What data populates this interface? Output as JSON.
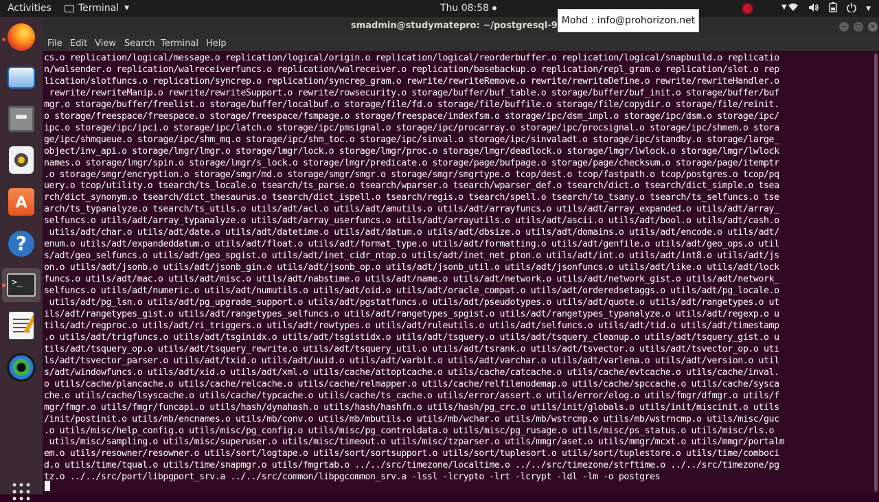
{
  "topbar": {
    "activities": "Activities",
    "app_name": "Terminal",
    "clock": "Thu 08:58"
  },
  "window": {
    "title": "smadmin@studymatepro: ~/postgresql-9.6.0-",
    "menu": [
      "File",
      "Edit",
      "View",
      "Search",
      "Terminal",
      "Help"
    ]
  },
  "overlay": {
    "text": "Mohd : info@prohorizon.net"
  },
  "dock": {
    "items": [
      "firefox-icon",
      "thunderbird-icon",
      "files-icon",
      "rhythmbox-icon",
      "software-center-icon",
      "help-icon",
      "terminal-icon",
      "text-editor-icon",
      "webcam-icon"
    ],
    "apps_grid": "show-applications-icon"
  },
  "terminal": {
    "lines": [
      "cs.o replication/logical/message.o replication/logical/origin.o replication/logical/reorderbuffer.o replication/logical/snapbuild.o replicatio",
      "n/walsender.o replication/walreceiverfuncs.o replication/walreceiver.o replication/basebackup.o replication/repl_gram.o replication/slot.o rep",
      "lication/slotfuncs.o replication/syncrep.o replication/syncrep_gram.o rewrite/rewriteRemove.o rewrite/rewriteDefine.o rewrite/rewriteHandler.o",
      " rewrite/rewriteManip.o rewrite/rewriteSupport.o rewrite/rowsecurity.o storage/buffer/buf_table.o storage/buffer/buf_init.o storage/buffer/buf",
      "mgr.o storage/buffer/freelist.o storage/buffer/localbuf.o storage/file/fd.o storage/file/buffile.o storage/file/copydir.o storage/file/reinit.",
      "o storage/freespace/freespace.o storage/freespace/fsmpage.o storage/freespace/indexfsm.o storage/ipc/dsm_impl.o storage/ipc/dsm.o storage/ipc/",
      "ipc.o storage/ipc/ipci.o storage/ipc/latch.o storage/ipc/pmsignal.o storage/ipc/procarray.o storage/ipc/procsignal.o storage/ipc/shmem.o stora",
      "ge/ipc/shmqueue.o storage/ipc/shm_mq.o storage/ipc/shm_toc.o storage/ipc/sinval.o storage/ipc/sinvaladt.o storage/ipc/standby.o storage/large_",
      "object/inv_api.o storage/lmgr/lmgr.o storage/lmgr/lock.o storage/lmgr/proc.o storage/lmgr/deadlock.o storage/lmgr/lwlock.o storage/lmgr/lwlock",
      "names.o storage/lmgr/spin.o storage/lmgr/s_lock.o storage/lmgr/predicate.o storage/page/bufpage.o storage/page/checksum.o storage/page/itemptr",
      ".o storage/smgr/encryption.o storage/smgr/md.o storage/smgr/smgr.o storage/smgr/smgrtype.o tcop/dest.o tcop/fastpath.o tcop/postgres.o tcop/pq",
      "uery.o tcop/utility.o tsearch/ts_locale.o tsearch/ts_parse.o tsearch/wparser.o tsearch/wparser_def.o tsearch/dict.o tsearch/dict_simple.o tsea",
      "rch/dict_synonym.o tsearch/dict_thesaurus.o tsearch/dict_ispell.o tsearch/regis.o tsearch/spell.o tsearch/to_tsany.o tsearch/ts_selfuncs.o tse",
      "arch/ts_typanalyze.o tsearch/ts_utils.o utils/adt/acl.o utils/adt/amutils.o utils/adt/arrayfuncs.o utils/adt/array_expanded.o utils/adt/array_",
      "selfuncs.o utils/adt/array_typanalyze.o utils/adt/array_userfuncs.o utils/adt/arrayutils.o utils/adt/ascii.o utils/adt/bool.o utils/adt/cash.o",
      " utils/adt/char.o utils/adt/date.o utils/adt/datetime.o utils/adt/datum.o utils/adt/dbsize.o utils/adt/domains.o utils/adt/encode.o utils/adt/",
      "enum.o utils/adt/expandeddatum.o utils/adt/float.o utils/adt/format_type.o utils/adt/formatting.o utils/adt/genfile.o utils/adt/geo_ops.o util",
      "s/adt/geo_selfuncs.o utils/adt/geo_spgist.o utils/adt/inet_cidr_ntop.o utils/adt/inet_net_pton.o utils/adt/int.o utils/adt/int8.o utils/adt/js",
      "on.o utils/adt/jsonb.o utils/adt/jsonb_gin.o utils/adt/jsonb_op.o utils/adt/jsonb_util.o utils/adt/jsonfuncs.o utils/adt/like.o utils/adt/lock",
      "funcs.o utils/adt/mac.o utils/adt/misc.o utils/adt/nabstime.o utils/adt/name.o utils/adt/network.o utils/adt/network_gist.o utils/adt/network_",
      "selfuncs.o utils/adt/numeric.o utils/adt/numutils.o utils/adt/oid.o utils/adt/oracle_compat.o utils/adt/orderedsetaggs.o utils/adt/pg_locale.o",
      " utils/adt/pg_lsn.o utils/adt/pg_upgrade_support.o utils/adt/pgstatfuncs.o utils/adt/pseudotypes.o utils/adt/quote.o utils/adt/rangetypes.o ut",
      "ils/adt/rangetypes_gist.o utils/adt/rangetypes_selfuncs.o utils/adt/rangetypes_spgist.o utils/adt/rangetypes_typanalyze.o utils/adt/regexp.o u",
      "tils/adt/regproc.o utils/adt/ri_triggers.o utils/adt/rowtypes.o utils/adt/ruleutils.o utils/adt/selfuncs.o utils/adt/tid.o utils/adt/timestamp",
      ".o utils/adt/trigfuncs.o utils/adt/tsginidx.o utils/adt/tsgistidx.o utils/adt/tsquery.o utils/adt/tsquery_cleanup.o utils/adt/tsquery_gist.o u",
      "tils/adt/tsquery_op.o utils/adt/tsquery_rewrite.o utils/adt/tsquery_util.o utils/adt/tsrank.o utils/adt/tsvector.o utils/adt/tsvector_op.o uti",
      "ls/adt/tsvector_parser.o utils/adt/txid.o utils/adt/uuid.o utils/adt/varbit.o utils/adt/varchar.o utils/adt/varlena.o utils/adt/version.o util",
      "s/adt/windowfuncs.o utils/adt/xid.o utils/adt/xml.o utils/cache/attoptcache.o utils/cache/catcache.o utils/cache/evtcache.o utils/cache/inval.",
      "o utils/cache/plancache.o utils/cache/relcache.o utils/cache/relmapper.o utils/cache/relfilenodemap.o utils/cache/spccache.o utils/cache/sysca",
      "che.o utils/cache/lsyscache.o utils/cache/typcache.o utils/cache/ts_cache.o utils/error/assert.o utils/error/elog.o utils/fmgr/dfmgr.o utils/f",
      "mgr/fmgr.o utils/fmgr/funcapi.o utils/hash/dynahash.o utils/hash/hashfn.o utils/hash/pg_crc.o utils/init/globals.o utils/init/miscinit.o utils",
      "/init/postinit.o utils/mb/encnames.o utils/mb/conv.o utils/mb/mbutils.o utils/mb/wchar.o utils/mb/wstrcmp.o utils/mb/wstrncmp.o utils/misc/guc",
      ".o utils/misc/help_config.o utils/misc/pg_config.o utils/misc/pg_controldata.o utils/misc/pg_rusage.o utils/misc/ps_status.o utils/misc/rls.o",
      " utils/misc/sampling.o utils/misc/superuser.o utils/misc/timeout.o utils/misc/tzparser.o utils/mmgr/aset.o utils/mmgr/mcxt.o utils/mmgr/portalm",
      "em.o utils/resowner/resowner.o utils/sort/logtape.o utils/sort/sortsupport.o utils/sort/tuplesort.o utils/sort/tuplestore.o utils/time/comboci",
      "d.o utils/time/tqual.o utils/time/snapmgr.o utils/fmgrtab.o ../../src/timezone/localtime.o ../../src/timezone/strftime.o ../../src/timezone/pg",
      "tz.o ../../src/port/libpgport_srv.a ../../src/common/libpgcommon_srv.a -lssl -lcrypto -lrt -lcrypt -ldl -lm -o postgres"
    ]
  }
}
